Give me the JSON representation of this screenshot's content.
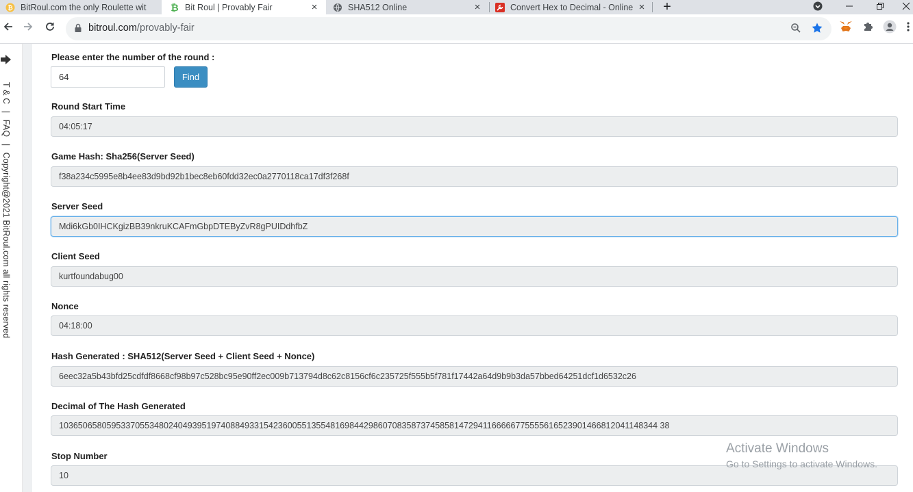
{
  "browser": {
    "tabs": [
      {
        "title": "BitRoul.com the only Roulette wit",
        "favicon": "bitcoin-coin-icon",
        "active": false
      },
      {
        "title": "Bit Roul | Provably Fair",
        "favicon": "bitcoin-b-icon",
        "active": true
      },
      {
        "title": "SHA512 Online",
        "favicon": "globe-icon",
        "active": false
      },
      {
        "title": "Convert Hex to Decimal - Online",
        "favicon": "wrench-icon",
        "active": false
      }
    ],
    "new_tab_label": "+",
    "close_glyph": "×",
    "address": {
      "domain": "bitroul.com",
      "path": "/provably-fair"
    }
  },
  "sidebar": {
    "links": [
      "T & C",
      "FAQ"
    ],
    "separator": "|",
    "copyright": "Copyright@2021 BitRoul.com all rights reserved"
  },
  "form": {
    "round_prompt": "Please enter the number of the round :",
    "round_value": "64",
    "find_label": "Find",
    "fields": [
      {
        "label": "Round Start Time",
        "value": "04:05:17"
      },
      {
        "label": "Game Hash: Sha256(Server Seed)",
        "value": "f38a234c5995e8b4ee83d9bd92b1bec8eb60fdd32ec0a2770118ca17df3f268f"
      },
      {
        "label": "Server Seed",
        "value": "Mdi6kGb0IHCKgizBB39nkruKCAFmGbpDTEByZvR8gPUIDdhfbZ"
      },
      {
        "label": "Client Seed",
        "value": "kurtfoundabug00"
      },
      {
        "label": "Nonce",
        "value": "04:18:00"
      },
      {
        "label": "Hash Generated : SHA512(Server Seed + Client Seed + Nonce)",
        "value": "6eec32a5b43bfd25cdfdf8668cf98b97c528bc95e90ff2ec009b713794d8c62c8156cf6c235725f555b5f781f17442a64d9b9b3da57bbed64251dcf1d6532c26"
      },
      {
        "label": "Decimal of The Hash Generated",
        "value": "103650658059533705534802404939519740884933154236005513554816984429860708358737458581472941166666775555616523901466812041148344 38"
      },
      {
        "label": "Stop Number",
        "value": "10"
      }
    ]
  },
  "watermark": {
    "title": "Activate Windows",
    "subtitle": "Go to Settings to activate Windows."
  },
  "colors": {
    "accent": "#3b8ec2",
    "focus": "#66afe9",
    "field_bg": "#eceeef"
  }
}
